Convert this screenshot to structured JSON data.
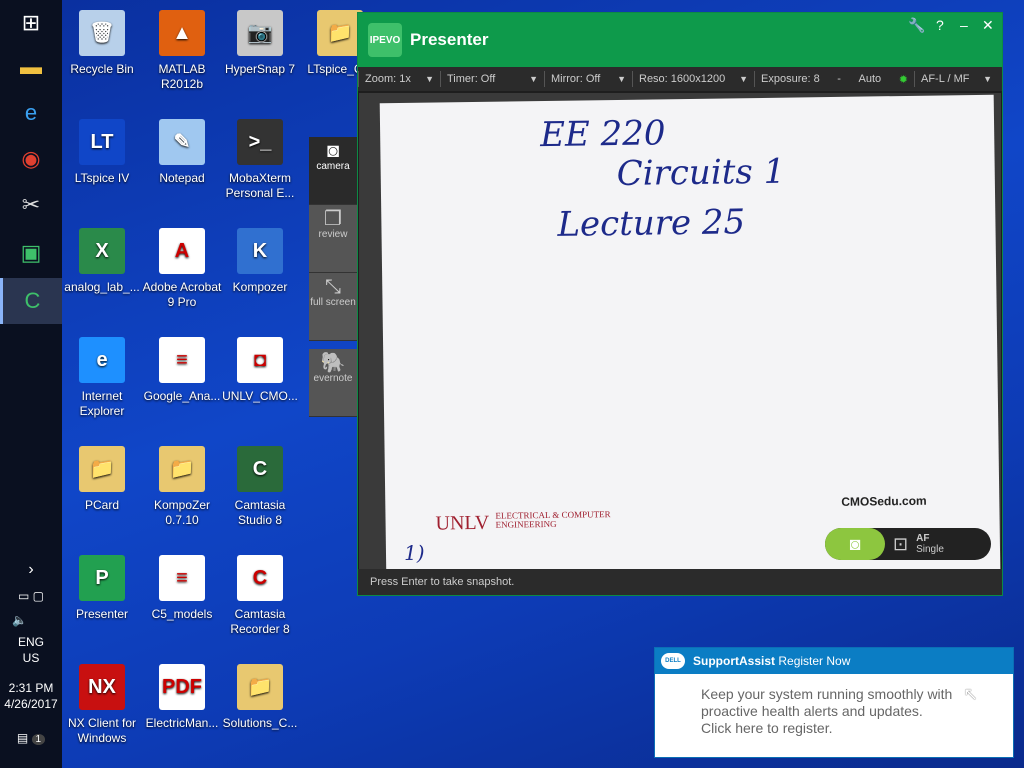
{
  "taskbar": {
    "tray": {
      "language": "ENG",
      "region": "US",
      "time": "2:31 PM",
      "date": "4/26/2017",
      "notifications": "1"
    }
  },
  "desktop_icons": [
    {
      "label": "Recycle Bin",
      "glyph": "🗑",
      "bg": "#b8d0ea"
    },
    {
      "label": "MATLAB R2012b",
      "glyph": "▲",
      "bg": "#e06010"
    },
    {
      "label": "HyperSnap 7",
      "glyph": "📷",
      "bg": "#c8c8c8"
    },
    {
      "label": "LTspice_C...",
      "glyph": "📁",
      "bg": "#e8c870"
    },
    {
      "label": "LTspice IV",
      "glyph": "LT",
      "bg": "#1046c8"
    },
    {
      "label": "Notepad",
      "glyph": "✎",
      "bg": "#a0c8f0"
    },
    {
      "label": "MobaXterm Personal E...",
      "glyph": ">_",
      "bg": "#333"
    },
    {
      "label": "analog_lab_...",
      "glyph": "X",
      "bg": "#2a8a4a"
    },
    {
      "label": "Adobe Acrobat 9 Pro",
      "glyph": "A",
      "bg": "#fff"
    },
    {
      "label": "Kompozer",
      "glyph": "K",
      "bg": "#3070d0"
    },
    {
      "label": "Internet Explorer",
      "glyph": "e",
      "bg": "#1e90ff"
    },
    {
      "label": "Google_Ana...",
      "glyph": "≡",
      "bg": "#fff"
    },
    {
      "label": "UNLV_CMO...",
      "glyph": "◘",
      "bg": "#fff"
    },
    {
      "label": "PCard",
      "glyph": "📁",
      "bg": "#e8c870"
    },
    {
      "label": "KompoZer 0.7.10",
      "glyph": "📁",
      "bg": "#e8c870"
    },
    {
      "label": "Camtasia Studio 8",
      "glyph": "C",
      "bg": "#2a6a3a"
    },
    {
      "label": "Presenter",
      "glyph": "P",
      "bg": "#22a050"
    },
    {
      "label": "C5_models",
      "glyph": "≡",
      "bg": "#fff"
    },
    {
      "label": "Camtasia Recorder 8",
      "glyph": "C",
      "bg": "#fff"
    },
    {
      "label": "NX Client for Windows",
      "glyph": "NX",
      "bg": "#c81010"
    },
    {
      "label": "ElectricMan...",
      "glyph": "PDF",
      "bg": "#fff"
    },
    {
      "label": "Solutions_C...",
      "glyph": "📁",
      "bg": "#e8c870"
    }
  ],
  "presenter": {
    "logo": "IPEVO",
    "title": "Presenter",
    "toolbar": {
      "zoom": "Zoom: 1x",
      "timer": "Timer: Off",
      "mirror": "Mirror: Off",
      "reso": "Reso: 1600x1200",
      "exposure": "Exposure: 8",
      "exposure_minus": "-",
      "auto": "Auto",
      "af": "AF-L / MF"
    },
    "paper": {
      "line1": "EE 220",
      "line2": "Circuits 1",
      "line3": "Lecture 25",
      "page": "1)",
      "unlv": "UNLV",
      "dept": "ELECTRICAL & COMPUTER ENGINEERING",
      "site": "CMOSedu.com"
    },
    "af": {
      "label": "AF",
      "mode": "Single"
    },
    "status": "Press Enter to take snapshot.",
    "side": {
      "camera": "camera",
      "review": "review",
      "fullscreen": "full screen",
      "evernote": "evernote"
    }
  },
  "support": {
    "brand": "DELL",
    "app": "SupportAssist",
    "action": "Register Now",
    "line1": "Keep your system running smoothly with",
    "line2": "proactive health alerts and updates.",
    "line3": "Click here to register."
  }
}
